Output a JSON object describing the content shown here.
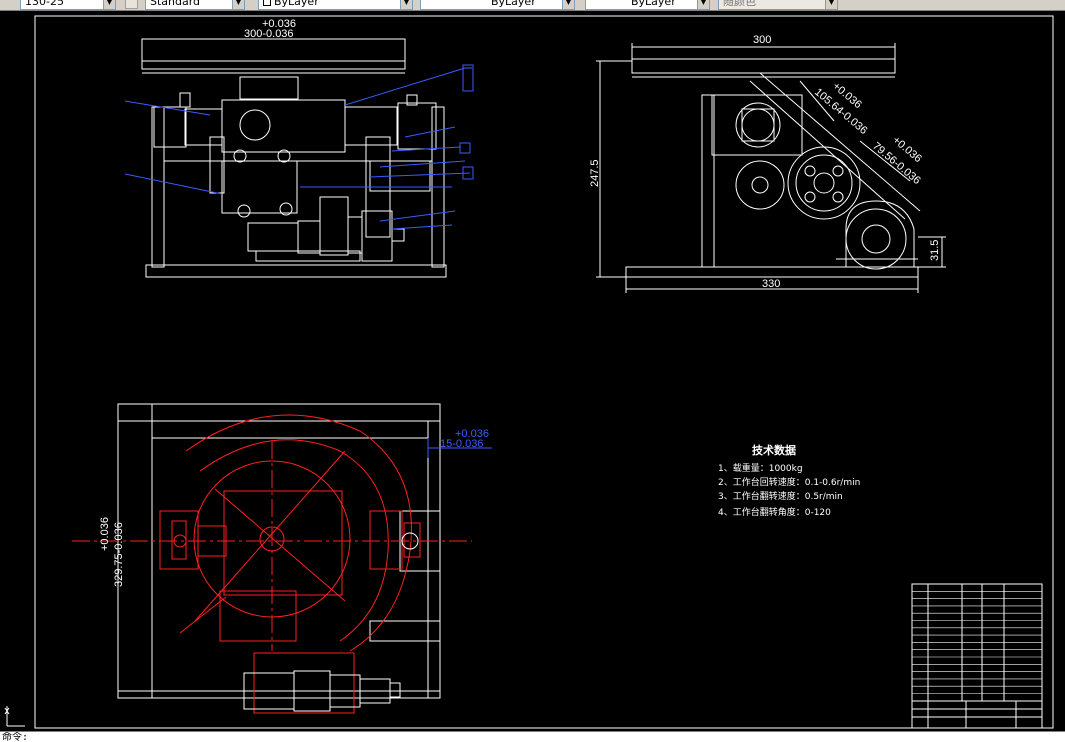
{
  "toolbar": {
    "text_style_value": "130-25",
    "dim_style_value": "Standard",
    "layer_value": "ByLayer",
    "linetype_value": "ByLayer",
    "lineweight_value": "ByLayer",
    "plotstyle_value": "随颜色"
  },
  "side_view": {
    "top_tolerance": "+0.036",
    "width_dim": "300-0.036"
  },
  "front_view": {
    "top_width": "300",
    "height_dim": "247.5",
    "bottom_width": "330",
    "diag_dim_1": "105.64-0.036",
    "diag_dim_1_tol": "+0.036",
    "diag_dim_2": "79.56-0.036",
    "diag_dim_2_tol": "+0.036",
    "small_height": "31.5"
  },
  "plan_view": {
    "right_tolerance": "+0.036",
    "right_dim": "15-0.036",
    "left_tolerance": "+0.036",
    "left_dim": "329.75-0.036"
  },
  "tech_notes": {
    "title": "技术数据",
    "items": [
      "1、载重量：1000kg",
      "2、工作台回转速度：0.1-0.6r/min",
      "3、工作台翻转速度：0.5r/min",
      "4、工作台翻转角度：0-120"
    ]
  },
  "colors": {
    "background": "#000000",
    "line_white": "#ffffff",
    "line_blue": "#3a5cff",
    "line_red": "#ff2020",
    "toolbar_bg": "#d4d0c8"
  },
  "command_line": {
    "prompt": "命令:"
  }
}
